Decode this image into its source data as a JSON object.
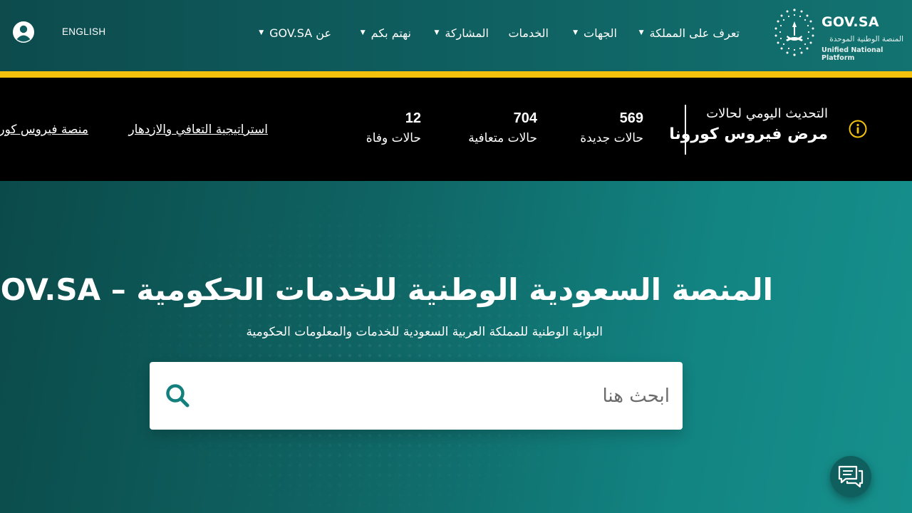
{
  "header": {
    "logo": {
      "title": "GOV.SA",
      "subtitle_ar": "المنصة الوطنية الموحدة",
      "subtitle_en": "Unified National Platform"
    },
    "nav": [
      {
        "label": "تعرف على المملكة",
        "has_dropdown": true
      },
      {
        "label": "الجهات",
        "has_dropdown": true
      },
      {
        "label": "الخدمات",
        "has_dropdown": false
      },
      {
        "label": "المشاركة",
        "has_dropdown": true
      },
      {
        "label": "نهتم بكم",
        "has_dropdown": true
      },
      {
        "label": "عن GOV.SA",
        "has_dropdown": true
      }
    ],
    "language_link": "ENGLISH",
    "icons": {
      "user": "user-icon",
      "caret": "caret-down-icon"
    },
    "accent_color": "#f4c20d"
  },
  "covid": {
    "title_line1": "التحديث اليومي لحالات",
    "title_line2": "مرض فيروس كورونا",
    "stats": [
      {
        "value": "569",
        "label": "حالات جديدة"
      },
      {
        "value": "704",
        "label": "حالات متعافية"
      },
      {
        "value": "12",
        "label": "حالات وفاة"
      }
    ],
    "links": [
      {
        "label": "استراتيجية التعافي والازدهار"
      },
      {
        "label": "منصة فيروس كورونا"
      }
    ],
    "icon": "info-icon"
  },
  "hero": {
    "title": "المنصة السعودية الوطنية للخدمات الحكومية – GOV.SA",
    "subtitle": "البوابة الوطنية للمملكة العربية السعودية للخدمات والمعلومات الحكومية",
    "search": {
      "placeholder": "ابحث هنا",
      "value": "",
      "icon": "search-icon"
    },
    "chat_icon": "chat-icon"
  },
  "colors": {
    "header_bg": "#0f5d5e",
    "teal_icon": "#14807d",
    "gold": "#f4c20d"
  }
}
